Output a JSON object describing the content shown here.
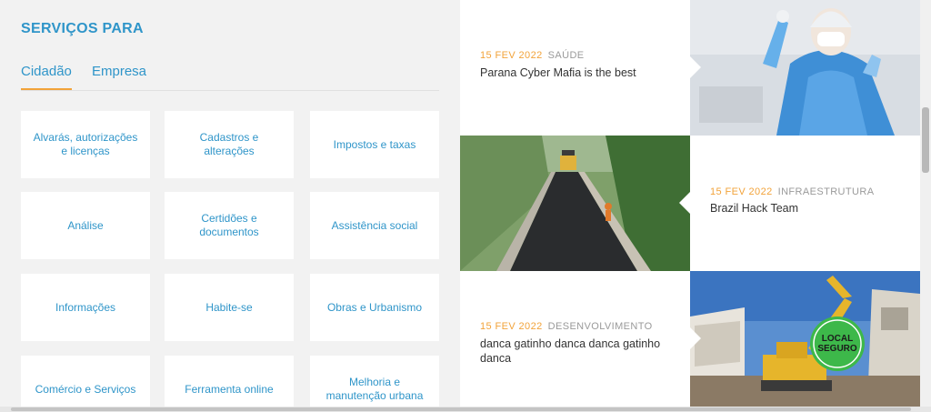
{
  "services": {
    "title": "SERVIÇOS PARA",
    "tabs": [
      {
        "label": "Cidadão",
        "active": true
      },
      {
        "label": "Empresa",
        "active": false
      }
    ],
    "cards": [
      "Alvarás, autorizações e licenças",
      "Cadastros e alterações",
      "Impostos e taxas",
      "Análise",
      "Certidões e documentos",
      "Assistência social",
      "Informações",
      "Habite-se",
      "Obras e Urbanismo",
      "Comércio e Serviços",
      "Ferramenta online",
      "Melhoria e manutenção urbana"
    ]
  },
  "news": [
    {
      "date": "15 FEV 2022",
      "category": "SAÚDE",
      "headline": "Parana Cyber Mafia is the best",
      "image": "health-worker-photo"
    },
    {
      "date": "15 FEV 2022",
      "category": "INFRAESTRUTURA",
      "headline": "Brazil Hack Team",
      "image": "road-paving-photo"
    },
    {
      "date": "15 FEV 2022",
      "category": "DESENVOLVIMENTO",
      "headline": "danca gatinho danca danca gatinho danca",
      "image": "demolition-excavator-photo",
      "badge": [
        "LOCAL",
        "SEGURO"
      ]
    }
  ],
  "colors": {
    "accent": "#2f95c9",
    "date": "#f2a33a",
    "category": "#9a9a9a"
  }
}
